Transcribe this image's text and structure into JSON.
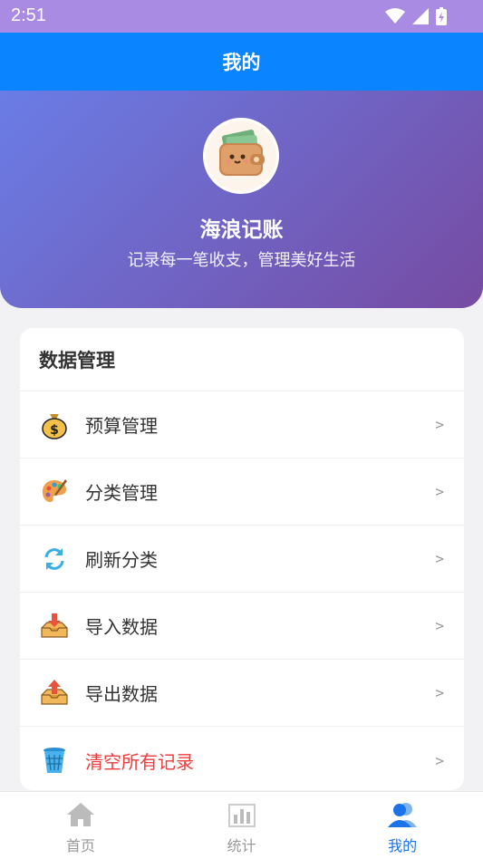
{
  "status_bar": {
    "time": "2:51"
  },
  "app_bar": {
    "title": "我的"
  },
  "profile": {
    "app_name": "海浪记账",
    "tagline": "记录每一笔收支，管理美好生活",
    "avatar_icon": "wallet-icon"
  },
  "data_section": {
    "title": "数据管理",
    "items": [
      {
        "label": "预算管理",
        "icon": "money-bag-icon"
      },
      {
        "label": "分类管理",
        "icon": "palette-icon"
      },
      {
        "label": "刷新分类",
        "icon": "refresh-icon"
      },
      {
        "label": "导入数据",
        "icon": "import-tray-icon"
      },
      {
        "label": "导出数据",
        "icon": "export-tray-icon"
      },
      {
        "label": "清空所有记录",
        "icon": "trash-icon",
        "danger": true
      }
    ],
    "chevron": ">"
  },
  "tab_bar": {
    "tabs": [
      {
        "label": "首页",
        "icon": "home-icon"
      },
      {
        "label": "统计",
        "icon": "bar-chart-icon"
      },
      {
        "label": "我的",
        "icon": "user-icon",
        "active": true
      }
    ]
  },
  "colors": {
    "primary": "#0a84ff",
    "danger": "#ee3b3b",
    "active_tab": "#1a73e8",
    "hero_start": "#6a7de6",
    "hero_end": "#764ba2"
  }
}
